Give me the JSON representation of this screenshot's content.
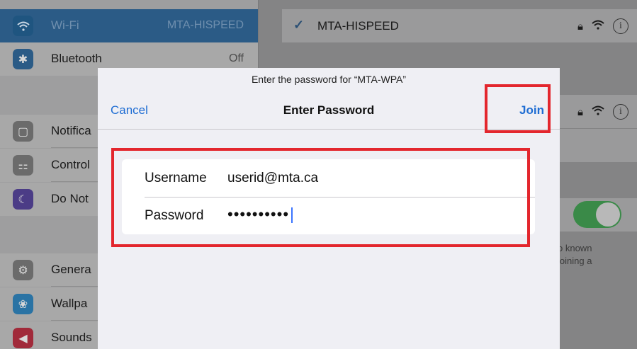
{
  "sidebar": {
    "items": [
      {
        "label": "Wi-Fi",
        "value": "MTA-HISPEED",
        "icon": "wifi-icon",
        "color": "#2b5b86"
      },
      {
        "label": "Bluetooth",
        "value": "Off",
        "icon": "bluetooth-icon",
        "color": "#2b5b86"
      },
      {
        "label": "Notifica",
        "value": "",
        "icon": "notifications-icon",
        "color": "#6b6b6b"
      },
      {
        "label": "Control",
        "value": "",
        "icon": "control-center-icon",
        "color": "#6b6b6b"
      },
      {
        "label": "Do Not",
        "value": "",
        "icon": "moon-icon",
        "color": "#4b3c86"
      },
      {
        "label": "Genera",
        "value": "",
        "icon": "gear-icon",
        "color": "#6b6b6b"
      },
      {
        "label": "Wallpa",
        "value": "",
        "icon": "wallpaper-icon",
        "color": "#2a73a4"
      },
      {
        "label": "Sounds",
        "value": "",
        "icon": "speaker-icon",
        "color": "#a12a3a"
      }
    ]
  },
  "detail": {
    "connected_network": "MTA-HISPEED",
    "note_line1": "o known",
    "note_line2": "joining a"
  },
  "dialog": {
    "prompt": "Enter the password for “MTA-WPA”",
    "title": "Enter Password",
    "cancel_label": "Cancel",
    "join_label": "Join",
    "username_label": "Username",
    "username_value": "userid@mta.ca",
    "password_label": "Password",
    "password_value": "••••••••••"
  },
  "colors": {
    "accent": "#1f6dd3",
    "highlight": "#e3262d",
    "toggle_on": "#3a8a48"
  }
}
